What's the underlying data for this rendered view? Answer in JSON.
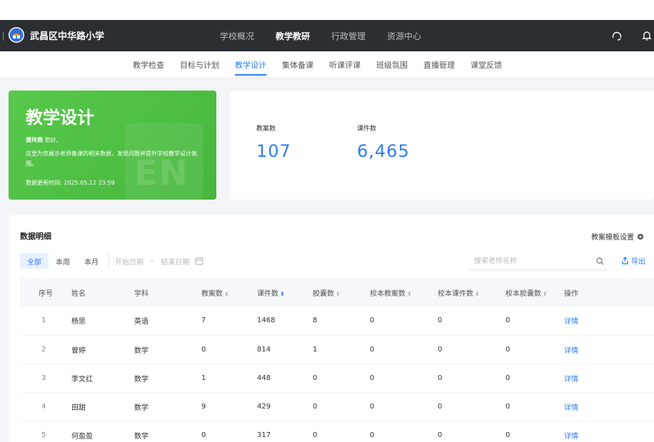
{
  "app": {
    "school_name": "武昌区中华路小学",
    "nav": [
      "学校概况",
      "教学教研",
      "行政管理",
      "资源中心"
    ],
    "nav_active": 1,
    "subnav": [
      "教学检查",
      "目标与计划",
      "教学设计",
      "集体备课",
      "听课评课",
      "班级氛围",
      "直播管理",
      "课堂反馈"
    ],
    "subnav_active": 2
  },
  "hero": {
    "title": "教学设计",
    "bg_text": "EN",
    "greeting_name": "黄玲燕",
    "greeting_suffix": "您好,",
    "desc": "这里为您展示老师备课的相关数据，发现问题并提升学校教学设计氛围。",
    "updated": "数据更新时间: 2025.05.12 23:59"
  },
  "stats": [
    {
      "label": "教案数",
      "value": "107"
    },
    {
      "label": "课件数",
      "value": "6,465"
    }
  ],
  "panel": {
    "title": "数据明细",
    "template_setting": "教案模板设置",
    "filters": [
      "全部",
      "本周",
      "本月"
    ],
    "filter_active": 0,
    "date_start_placeholder": "开始日期",
    "date_sep": "~",
    "date_end_placeholder": "结束日期",
    "search_placeholder": "搜索老师名称",
    "export": "导出"
  },
  "table": {
    "columns": [
      "序号",
      "姓名",
      "学科",
      "教案数",
      "课件数",
      "胶囊数",
      "校本教案数",
      "校本课件数",
      "校本胶囊数",
      "操作"
    ],
    "rows": [
      [
        "1",
        "杨思",
        "英语",
        "7",
        "1468",
        "8",
        "0",
        "0",
        "0",
        "详情"
      ],
      [
        "2",
        "曾婷",
        "数学",
        "0",
        "814",
        "1",
        "0",
        "0",
        "0",
        "详情"
      ],
      [
        "3",
        "李文红",
        "数学",
        "1",
        "448",
        "0",
        "0",
        "0",
        "0",
        "详情"
      ],
      [
        "4",
        "田甜",
        "数学",
        "9",
        "429",
        "0",
        "0",
        "0",
        "0",
        "详情"
      ],
      [
        "5",
        "何盈盈",
        "数学",
        "0",
        "317",
        "0",
        "0",
        "0",
        "0",
        "详情"
      ]
    ]
  },
  "colors": {
    "accent": "#2d7ff9",
    "hero_green": "#4bbd41",
    "navbar": "#2b2f33"
  }
}
